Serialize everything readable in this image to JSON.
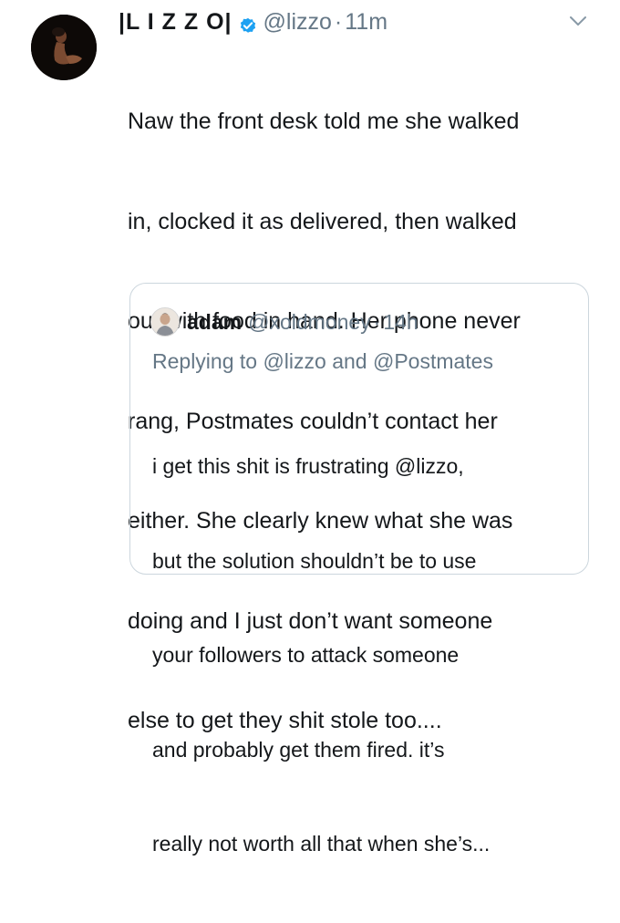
{
  "tweet": {
    "display_name": "|L I Z Z O|",
    "handle": "@lizzo",
    "separator": "·",
    "time": "11m",
    "avatar_icon": "profile-photo",
    "verified_icon": "verified-badge-icon",
    "menu_icon": "chevron-down-icon",
    "lines": [
      "Naw the front desk told me she walked",
      "in, clocked it as delivered, then walked",
      "out with food in hand. Her phone never",
      "rang, Postmates couldn’t contact her",
      "either. She clearly knew what she was",
      "doing and I just don’t want someone",
      "else to get they shit stole too...."
    ]
  },
  "quoted_tweet": {
    "display_name": "adam",
    "handle": "@xoldmoney",
    "separator": "·",
    "time": "14h",
    "avatar_icon": "profile-photo",
    "replying_to": "Replying to @lizzo and @Postmates",
    "lines": [
      "i get this shit is frustrating @lizzo,",
      "but the solution shouldn’t be to use",
      "your followers to attack someone",
      "and probably get them fired. it’s",
      "really not worth all that when she’s..."
    ]
  },
  "colors": {
    "text": "#14171a",
    "secondary": "#657786",
    "verified": "#1da1f2",
    "border": "#ccd6dd"
  }
}
